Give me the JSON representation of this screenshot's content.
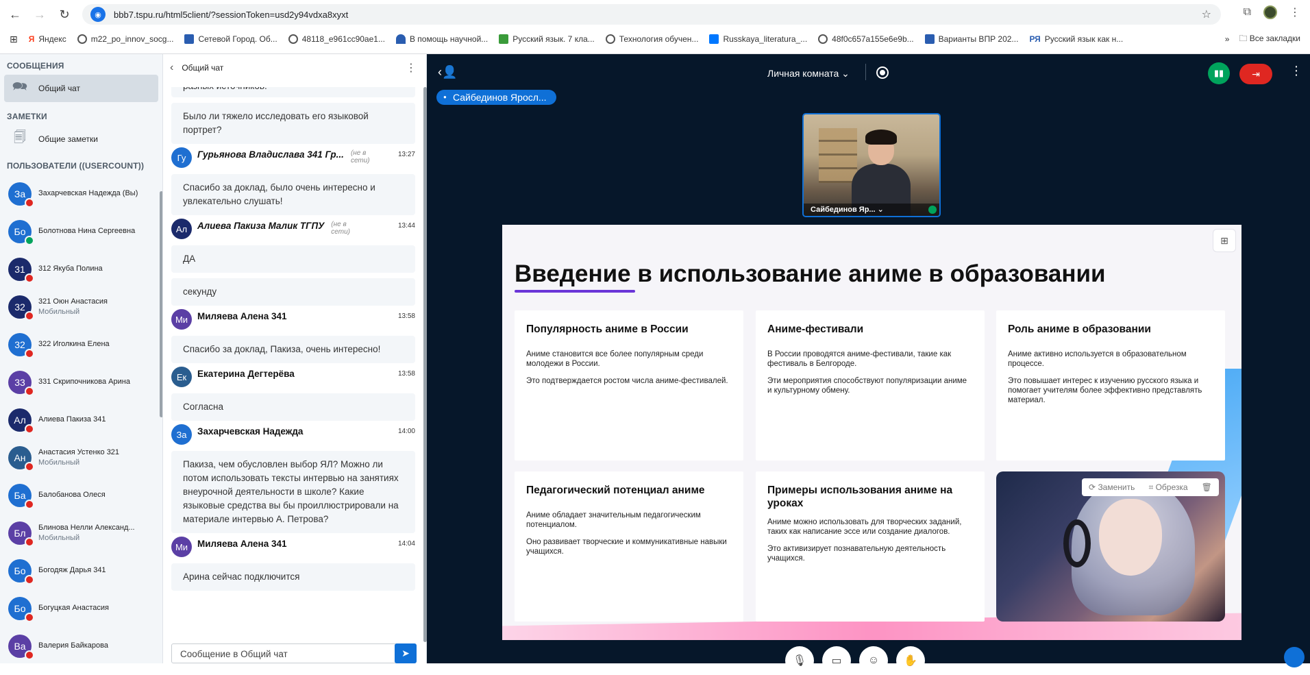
{
  "browser": {
    "url": "bbb7.tspu.ru/html5client/?sessionToken=usd2y94vdxa8xyxt",
    "bookmarks": [
      {
        "label": "Яндекс",
        "color": "#fc3f1d"
      },
      {
        "label": "m22_po_innov_socg...",
        "color": "#555555"
      },
      {
        "label": "Сетевой Город. Об...",
        "color": "#2a5db0"
      },
      {
        "label": "48118_e961cc90ae1...",
        "color": "#555555"
      },
      {
        "label": "В помощь научной...",
        "color": "#2a5db0"
      },
      {
        "label": "Русский язык. 7 кла...",
        "color": "#3a9b3a"
      },
      {
        "label": "Технология обучен...",
        "color": "#555555"
      },
      {
        "label": "Russkaya_literatura_...",
        "color": "#0077ff"
      },
      {
        "label": "48f0c657a155e6e9b...",
        "color": "#555555"
      },
      {
        "label": "Варианты ВПР 202...",
        "color": "#2a5db0"
      },
      {
        "label": "Русский язык как н...",
        "color": "#2a5db0"
      }
    ],
    "all_bookmarks": "Все закладки",
    "ya_glyph": "Я",
    "ru_glyph": "РЯ"
  },
  "sidebar": {
    "messages_header": "СООБЩЕНИЯ",
    "public_chat": "Общий чат",
    "notes_header": "ЗАМЕТКИ",
    "shared_notes": "Общие заметки",
    "users_header": "ПОЛЬЗОВАТЕЛИ ((USERCOUNT))",
    "users": [
      {
        "initials": "За",
        "name": "Захарчевская Надежда (Вы)",
        "sub": "",
        "color": "#1f6fd1",
        "mic": "off"
      },
      {
        "initials": "Бо",
        "name": "Болотнова Нина Сергеевна",
        "sub": "",
        "color": "#1f6fd1",
        "mic": "on"
      },
      {
        "initials": "31",
        "name": "312 Якуба Полина",
        "sub": "",
        "color": "#1b2a6b",
        "mic": "off"
      },
      {
        "initials": "32",
        "name": "321 Оюн Анастасия",
        "sub": "Мобильный",
        "color": "#1b2a6b",
        "mic": "off"
      },
      {
        "initials": "32",
        "name": "322 Иголкина Елена",
        "sub": "",
        "color": "#1f6fd1",
        "mic": "off"
      },
      {
        "initials": "33",
        "name": "331 Скрипочникова Арина",
        "sub": "",
        "color": "#5b3fa5",
        "mic": "off"
      },
      {
        "initials": "Ал",
        "name": "Алиева Пакиза 341",
        "sub": "",
        "color": "#1b2a6b",
        "mic": "off"
      },
      {
        "initials": "Ан",
        "name": "Анастасия Устенко 321",
        "sub": "Мобильный",
        "color": "#2a5d8f",
        "mic": "off"
      },
      {
        "initials": "Ба",
        "name": "Балобанова Олеся",
        "sub": "",
        "color": "#1f6fd1",
        "mic": "off"
      },
      {
        "initials": "Бл",
        "name": "Блинова Нелли Александ...",
        "sub": "Мобильный",
        "color": "#5b3fa5",
        "mic": "off"
      },
      {
        "initials": "Бо",
        "name": "Богодяж Дарья 341",
        "sub": "",
        "color": "#1f6fd1",
        "mic": "off"
      },
      {
        "initials": "Бо",
        "name": "Богуцкая Анастасия",
        "sub": "",
        "color": "#1f6fd1",
        "mic": "off"
      },
      {
        "initials": "Ва",
        "name": "Валерия Байкарова",
        "sub": "",
        "color": "#5b3fa5",
        "mic": "off"
      }
    ]
  },
  "chat": {
    "title": "Общий чат",
    "top_partial": "разных источников.",
    "messages": [
      {
        "kind": "bubble",
        "text": "Было ли тяжело исследовать его языковой портрет?"
      },
      {
        "kind": "head",
        "initials": "Гу",
        "name": "Гурьянова Владислава 341 Гр...",
        "offline": "(не в сети)",
        "time": "13:27",
        "color": "#1f6fd1"
      },
      {
        "kind": "bubble",
        "text": "Спасибо за доклад, было очень интересно и увлекательно слушать!"
      },
      {
        "kind": "head",
        "initials": "Ал",
        "name": "Алиева Пакиза Малик ТГПУ",
        "offline": "(не в сети)",
        "time": "13:44",
        "color": "#1b2a6b"
      },
      {
        "kind": "bubble",
        "text": "ДА"
      },
      {
        "kind": "bubble",
        "text": "секунду"
      },
      {
        "kind": "head",
        "initials": "Ми",
        "name": "Миляева Алена 341",
        "offline": "",
        "time": "13:58",
        "color": "#5b3fa5"
      },
      {
        "kind": "bubble",
        "text": "Спасибо за доклад, Пакиза, очень интересно!"
      },
      {
        "kind": "head",
        "initials": "Ек",
        "name": "Екатерина Дегтерёва",
        "offline": "",
        "time": "13:58",
        "color": "#2a5d8f"
      },
      {
        "kind": "bubble",
        "text": "Согласна"
      },
      {
        "kind": "head",
        "initials": "За",
        "name": "Захарчевская Надежда",
        "offline": "",
        "time": "14:00",
        "color": "#1f6fd1"
      },
      {
        "kind": "bubble",
        "text": "Пакиза, чем обусловлен выбор  ЯЛ? Можно ли потом использовать тексты интервью на занятиях внеурочной деятельности в школе? Какие языковые средства вы бы проиллюстрировали на материале интервью А. Петрова?"
      },
      {
        "kind": "head",
        "initials": "Ми",
        "name": "Миляева Алена 341",
        "offline": "",
        "time": "14:04",
        "color": "#5b3fa5"
      },
      {
        "kind": "bubble",
        "text": "Арина сейчас подключится"
      }
    ],
    "input_placeholder": "Сообщение в Общий чат"
  },
  "stage": {
    "room_label": "Личная комната",
    "talker": "Сайбединов Яросл...",
    "camera_name": "Сайбединов Яр...",
    "colors": {
      "bg": "#06172a",
      "accent": "#0f70d7",
      "leave": "#df2721",
      "connection": "#00a35c"
    }
  },
  "slide": {
    "title": "Введение в использование аниме в образовании",
    "cards": [
      {
        "heading": "Популярность аниме в России",
        "p1": "Аниме становится все более популярным среди молодежи в России.",
        "p2": "Это подтверждается ростом числа аниме-фестивалей."
      },
      {
        "heading": "Аниме-фестивали",
        "p1": "В России проводятся аниме-фестивали, такие как фестиваль в Белгороде.",
        "p2": "Эти мероприятия способствуют популяризации аниме и культурному обмену."
      },
      {
        "heading": "Роль аниме в образовании",
        "p1": "Аниме активно используется в образовательном процессе.",
        "p2": "Это повышает интерес к изучению русского языка и помогает учителям более эффективно представлять материал."
      },
      {
        "heading": "Педагогический потенциал аниме",
        "p1": "Аниме обладает значительным педагогическим потенциалом.",
        "p2": "Оно развивает творческие и коммуникативные навыки учащихся."
      },
      {
        "heading": "Примеры использования аниме на уроках",
        "p1": "Аниме можно использовать для творческих заданий, таких как написание эссе или создание диалогов.",
        "p2": "Это активизирует познавательную деятельность учащихся."
      }
    ],
    "image_tools": {
      "replace": "Заменить",
      "crop": "Обрезка"
    }
  }
}
